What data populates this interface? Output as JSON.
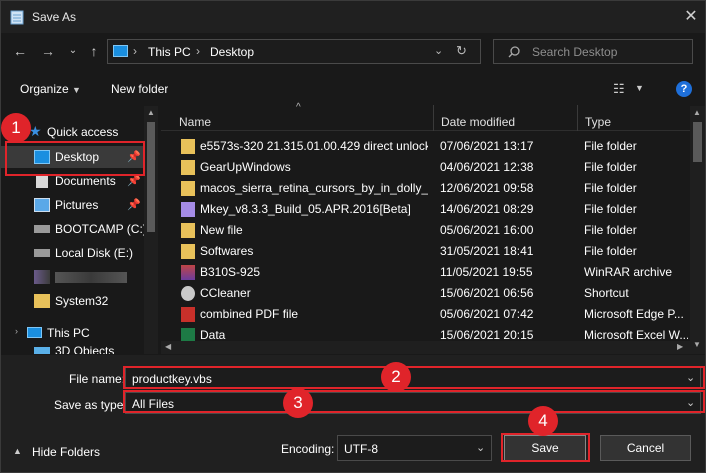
{
  "window": {
    "title": "Save As",
    "close_icon": "close-icon"
  },
  "nav": {
    "path": [
      "This PC",
      "Desktop"
    ],
    "search_placeholder": "Search Desktop"
  },
  "toolbar": {
    "organize": "Organize",
    "new_folder": "New folder"
  },
  "sidebar": {
    "quick_access": "Quick access",
    "items": [
      {
        "label": "Desktop",
        "pinned": true,
        "selected": true
      },
      {
        "label": "Documents",
        "pinned": true
      },
      {
        "label": "Pictures",
        "pinned": true
      },
      {
        "label": "BOOTCAMP (C:)"
      },
      {
        "label": "Local Disk (E:)"
      },
      {
        "label": ""
      },
      {
        "label": "System32"
      }
    ],
    "this_pc": "This PC",
    "objects_3d": "3D Objects"
  },
  "columns": {
    "name": "Name",
    "date": "Date modified",
    "type": "Type"
  },
  "files": [
    {
      "name": "e5573s-320 21.315.01.00.429 direct unlock...",
      "date": "07/06/2021 13:17",
      "type": "File folder",
      "icon": "folder"
    },
    {
      "name": "GearUpWindows",
      "date": "04/06/2021 12:38",
      "type": "File folder",
      "icon": "folder"
    },
    {
      "name": "macos_sierra_retina_cursors_by_in_dolly_...",
      "date": "12/06/2021 09:58",
      "type": "File folder",
      "icon": "folder"
    },
    {
      "name": "Mkey_v8.3.3_Build_05.APR.2016[Beta]",
      "date": "14/06/2021 08:29",
      "type": "File folder",
      "icon": "purple-folder"
    },
    {
      "name": "New file",
      "date": "05/06/2021 16:00",
      "type": "File folder",
      "icon": "folder"
    },
    {
      "name": "Softwares",
      "date": "31/05/2021 18:41",
      "type": "File folder",
      "icon": "folder"
    },
    {
      "name": "B310S-925",
      "date": "11/05/2021 19:55",
      "type": "WinRAR archive",
      "icon": "winrar"
    },
    {
      "name": "CCleaner",
      "date": "15/06/2021 06:56",
      "type": "Shortcut",
      "icon": "ccleaner"
    },
    {
      "name": "combined PDF file",
      "date": "05/06/2021 07:42",
      "type": "Microsoft Edge P...",
      "icon": "pdf"
    },
    {
      "name": "Data",
      "date": "15/06/2021 20:15",
      "type": "Microsoft Excel W...",
      "icon": "excel"
    }
  ],
  "form": {
    "file_name_label": "File name:",
    "file_name_value": "productkey.vbs",
    "save_type_label": "Save as type:",
    "save_type_value": "All Files",
    "encoding_label": "Encoding:",
    "encoding_value": "UTF-8",
    "hide_folders": "Hide Folders",
    "save": "Save",
    "cancel": "Cancel"
  },
  "callouts": [
    "1",
    "2",
    "3",
    "4"
  ],
  "colors": {
    "accent": "#e0242a",
    "folder": "#e8c15a",
    "help": "#1e6fd9"
  }
}
